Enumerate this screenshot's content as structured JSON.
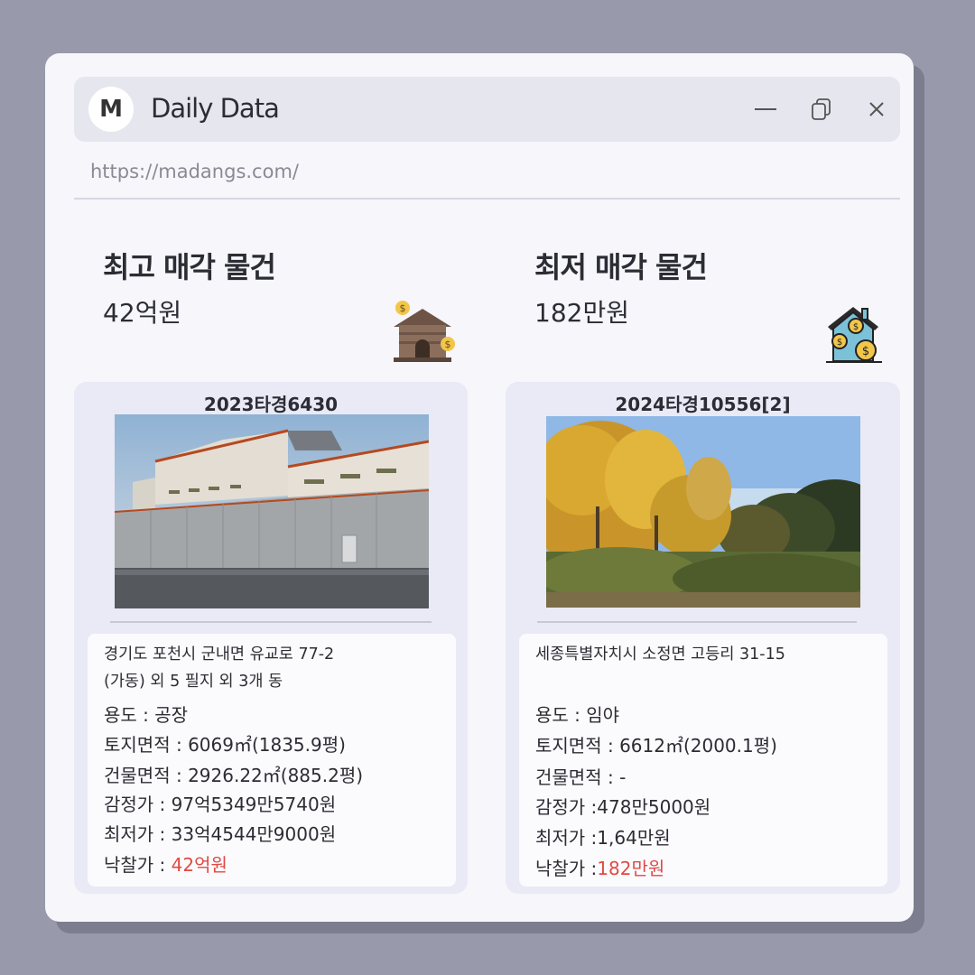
{
  "window": {
    "logo_letter": "M",
    "title": "Daily Data",
    "url": "https://madangs.com/"
  },
  "highest": {
    "heading": "최고 매각 물건",
    "price": "42억원",
    "icon": "house-with-money-icon",
    "case_no": "2023타경6430",
    "photo": "warehouse-factory-photo",
    "address_line1": "경기도 포천시 군내면 유교로 77-2",
    "address_line2": "(가동) 외 5 필지 외 3개 동",
    "usage_label": "용도 : ",
    "usage": "공장",
    "land_label": "토지면적 : ",
    "land_area": "6069㎡(1835.9평)",
    "building_label": "건물면적 : ",
    "building_area": "2926.22㎡(885.2평)",
    "appraisal_label": "감정가 : ",
    "appraisal": "97억5349만5740원",
    "minimum_label": "최저가 : ",
    "minimum": "33억4544만9000원",
    "winning_label": "낙찰가 : ",
    "winning": "42억원"
  },
  "lowest": {
    "heading": "최저 매각 물건",
    "price": "182만원",
    "icon": "house-coins-icon",
    "case_no": "2024타경10556[2]",
    "photo": "forest-ginkgo-photo",
    "address_line1": "세종특별자치시 소정면 고등리 31-15",
    "usage_label": "용도 : ",
    "usage": "임야",
    "land_label": "토지면적 : ",
    "land_area": "6612㎡(2000.1평)",
    "building_label": "건물면적 : ",
    "building_area": "-",
    "appraisal_label": "감정가 :",
    "appraisal": "478만5000원",
    "minimum_label": "최저가 :",
    "minimum": "1,64만원",
    "winning_label": "낙찰가 :",
    "winning": "182만원"
  },
  "colors": {
    "background": "#9899aa",
    "window": "#f6f6fb",
    "titlebar": "#e5e6ee",
    "card": "#e9eaf5",
    "accent_red": "#e04a43"
  }
}
